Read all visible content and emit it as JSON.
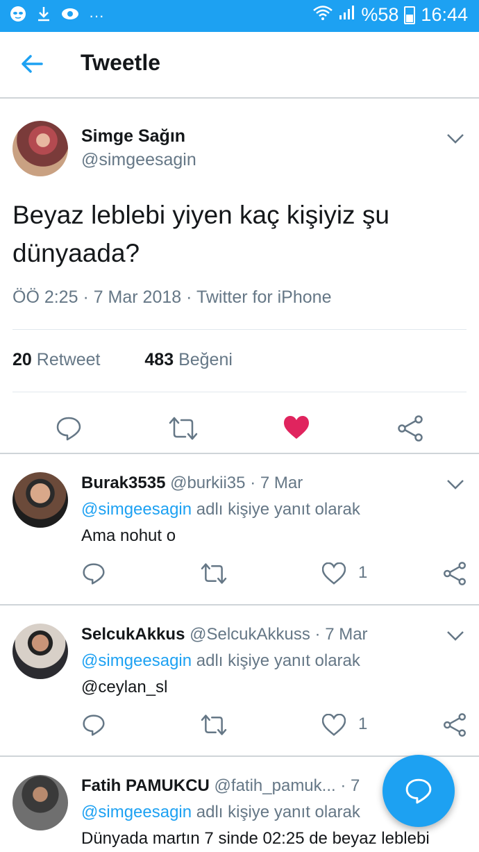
{
  "status_bar": {
    "battery": "%58",
    "time": "16:44",
    "dots": "···"
  },
  "app_bar": {
    "title": "Tweetle"
  },
  "main_tweet": {
    "name": "Simge Sağın",
    "handle": "@simgeesagin",
    "text": "Beyaz leblebi yiyen kaç kişiyiz şu dünyaada?",
    "meta": "ÖÖ 2:25 · 7 Mar 2018 · Twitter for iPhone",
    "retweets": "20",
    "retweets_label": "Retweet",
    "likes": "483",
    "likes_label": "Beğeni",
    "liked": true
  },
  "replies": [
    {
      "name": "Burak3535",
      "handle": "@burkii35",
      "date": "· 7 Mar",
      "reply_to": "@simgeesagin",
      "reply_suffix": "adlı kişiye yanıt olarak",
      "text": "Ama nohut o",
      "likes": "1"
    },
    {
      "name": "SelcukAkkus",
      "handle": "@SelcukAkkuss",
      "date": "· 7 Mar",
      "reply_to": "@simgeesagin",
      "reply_suffix": "adlı kişiye yanıt olarak",
      "text": "@ceylan_sl",
      "likes": "1"
    },
    {
      "name": "Fatih PAMUKCU",
      "handle": "@fatih_pamuk...",
      "date": "· 7",
      "reply_to": "@simgeesagin",
      "reply_suffix": "adlı kişiye yanıt olarak",
      "text": "Dünyada martın 7 sinde 02:25 de beyaz leblebi"
    }
  ],
  "colors": {
    "accent": "#1da1f2",
    "like": "#e0245e",
    "muted": "#657786"
  }
}
